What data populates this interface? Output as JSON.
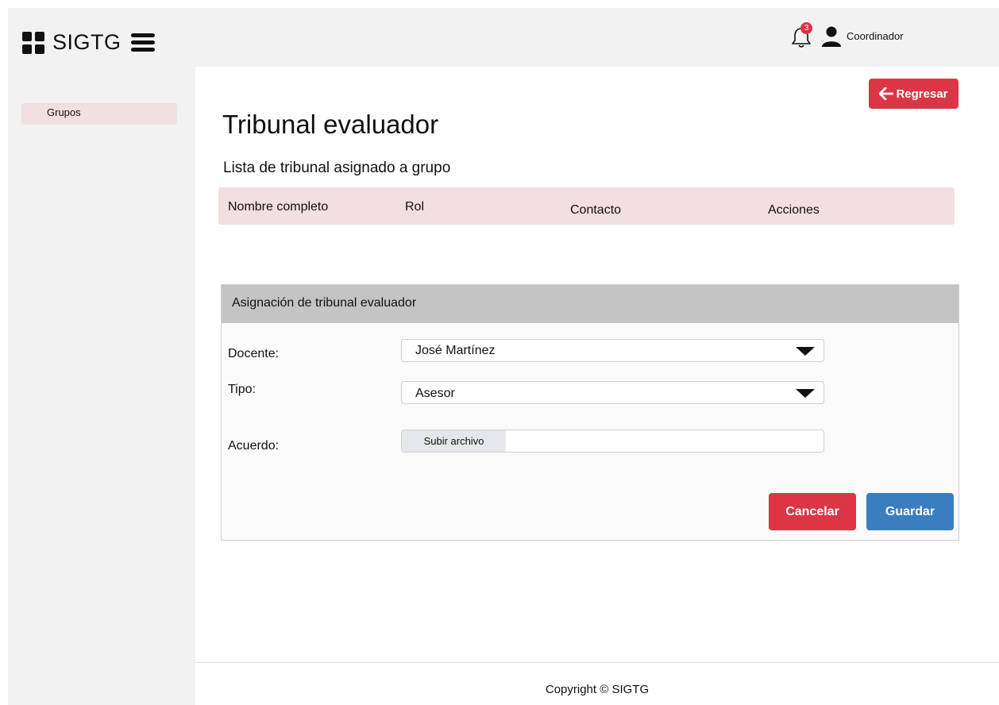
{
  "brand": {
    "name": "SIGTG"
  },
  "header": {
    "notification_count": "3",
    "user_name": "Coordinador"
  },
  "sidebar": {
    "items": [
      {
        "label": "Grupos"
      }
    ]
  },
  "main": {
    "back_button": "Regresar",
    "title": "Tribunal evaluador",
    "subtitle": "Lista de tribunal asignado a grupo",
    "table": {
      "columns": [
        "Nombre completo",
        "Rol",
        "Contacto",
        "Acciones"
      ],
      "rows": []
    }
  },
  "form": {
    "title": "Asignación de tribunal evaluador",
    "docente": {
      "label": "Docente:",
      "value": "José Martínez"
    },
    "tipo": {
      "label": "Tipo:",
      "value": "Asesor"
    },
    "acuerdo": {
      "label": "Acuerdo:",
      "button": "Subir archivo"
    },
    "cancel": "Cancelar",
    "save": "Guardar"
  },
  "footer": {
    "text": "Copyright © SIGTG"
  },
  "colors": {
    "danger": "#dc3545",
    "primary": "#3a7ebf",
    "highlight": "#f2dfe0",
    "panel_header": "#c4c4c4",
    "chrome": "#f2f2f2"
  }
}
